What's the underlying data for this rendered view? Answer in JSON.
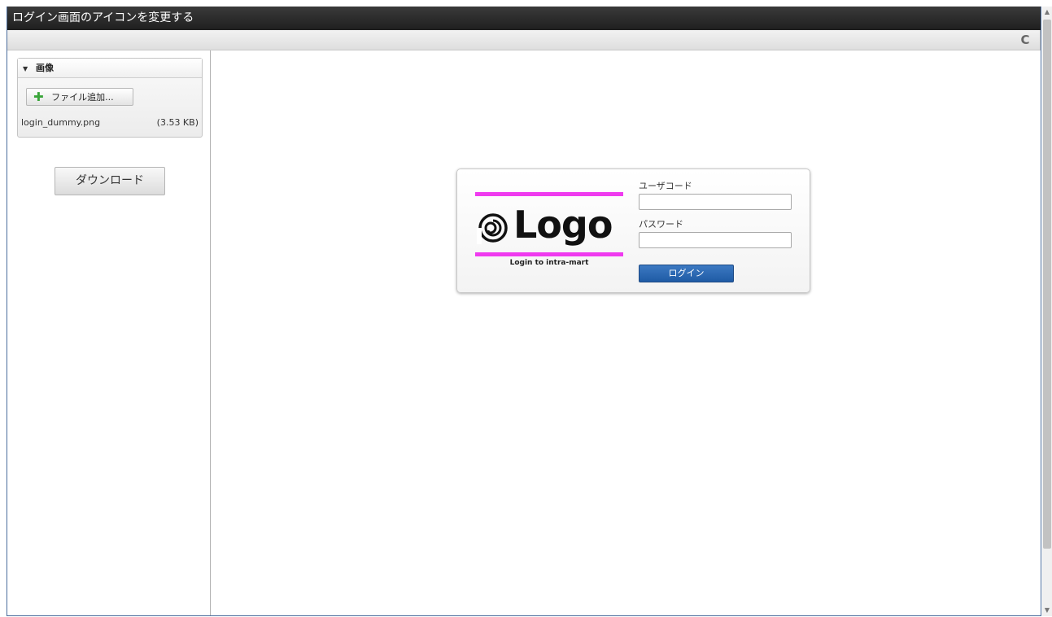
{
  "window": {
    "title": "ログイン画面のアイコンを変更する"
  },
  "toolbar": {
    "refresh_glyph": "C"
  },
  "sidebar": {
    "panel": {
      "header": "画像",
      "add_file_label": "ファイル追加...",
      "file": {
        "name": "login_dummy.png",
        "size": "(3.53 KB)"
      }
    },
    "download_label": "ダウンロード"
  },
  "login": {
    "logo_text": "Logo",
    "caption": "Login to intra-mart",
    "user_code_label": "ユーザコード",
    "user_code_value": "",
    "password_label": "パスワード",
    "password_value": "",
    "login_button": "ログイン",
    "accent_color": "#ef3aef"
  }
}
